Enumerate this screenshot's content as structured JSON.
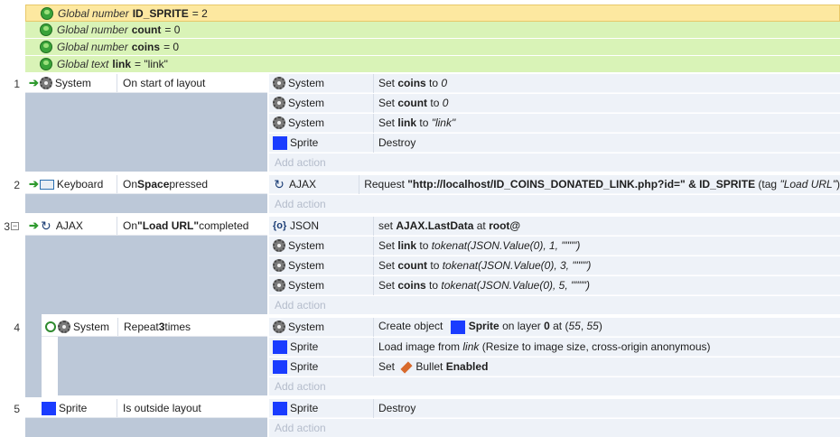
{
  "globals": [
    {
      "kind": "Global number",
      "name": "ID_SPRITE",
      "value": "= 2",
      "selected": true
    },
    {
      "kind": "Global number",
      "name": "count",
      "value": "= 0",
      "selected": false
    },
    {
      "kind": "Global number",
      "name": "coins",
      "value": "= 0",
      "selected": false
    },
    {
      "kind": "Global text",
      "name": "link",
      "value": "= \"link\"",
      "selected": false
    }
  ],
  "events": {
    "e1": {
      "num": "1",
      "cond_obj": "System",
      "cond_text": "On start of layout",
      "actions": [
        {
          "obj": "System",
          "t1": "Set ",
          "t2": "coins",
          "t3": " to ",
          "t4": "0"
        },
        {
          "obj": "System",
          "t1": "Set ",
          "t2": "count",
          "t3": " to ",
          "t4": "0"
        },
        {
          "obj": "System",
          "t1": "Set ",
          "t2": "link",
          "t3": " to ",
          "t4": "\"link\""
        },
        {
          "obj": "Sprite",
          "text": "Destroy"
        }
      ]
    },
    "e2": {
      "num": "2",
      "cond_obj": "Keyboard",
      "cond_pre": "On ",
      "cond_bold": "Space",
      "cond_post": " pressed",
      "action_obj": "AJAX",
      "action_pre": "Request ",
      "action_bold": "\"http://localhost/ID_COINS_DONATED_LINK.php?id=\" & ID_SPRITE",
      "action_mid": " (tag ",
      "action_italic": "\"Load URL\"",
      "action_post": ")"
    },
    "e3": {
      "num": "3",
      "collapse": "−",
      "cond_obj": "AJAX",
      "cond_pre": "On ",
      "cond_bold": "\"Load URL\"",
      "cond_post": " completed",
      "a1_obj": "JSON",
      "a1_pre": "set ",
      "a1_bold": "AJAX.LastData",
      "a1_mid": " at ",
      "a1_bold2": "root@",
      "actions": [
        {
          "obj": "System",
          "t1": "Set ",
          "t2": "link",
          "t3": " to ",
          "t4": "tokenat(JSON.Value(0), 1, \"\"\"\")"
        },
        {
          "obj": "System",
          "t1": "Set ",
          "t2": "count",
          "t3": " to ",
          "t4": "tokenat(JSON.Value(0), 3, \"\"\"\")"
        },
        {
          "obj": "System",
          "t1": "Set ",
          "t2": "coins",
          "t3": " to ",
          "t4": "tokenat(JSON.Value(0), 5, \"\"\"\")"
        }
      ]
    },
    "e4": {
      "num": "4",
      "cond_obj": "System",
      "cond_pre": "Repeat ",
      "cond_bold": "3",
      "cond_post": " times",
      "a1_obj": "System",
      "a1_pre": "Create object ",
      "a1_bold": "Sprite",
      "a1_mid": " on layer ",
      "a1_bold2": "0",
      "a1_post": " at (",
      "a1_x": "55",
      "a1_sep": ", ",
      "a1_y": "55",
      "a1_end": ")",
      "a2_obj": "Sprite",
      "a2_pre": "Load image from ",
      "a2_italic": "link",
      "a2_post": " (Resize to image size, cross-origin anonymous)",
      "a3_obj": "Sprite",
      "a3_pre": "Set ",
      "a3_mid": "Bullet ",
      "a3_bold": "Enabled"
    },
    "e5": {
      "num": "5",
      "cond_obj": "Sprite",
      "cond_text": "Is outside layout",
      "action_obj": "Sprite",
      "action_text": "Destroy"
    }
  },
  "add_action": "Add action",
  "colors": {
    "selected_global": "#fde8a0",
    "global_row": "#d9f3b7",
    "action_bg": "#eef2f8",
    "gutter": "#bcc8d8",
    "sprite_blue": "#1a3cff"
  }
}
